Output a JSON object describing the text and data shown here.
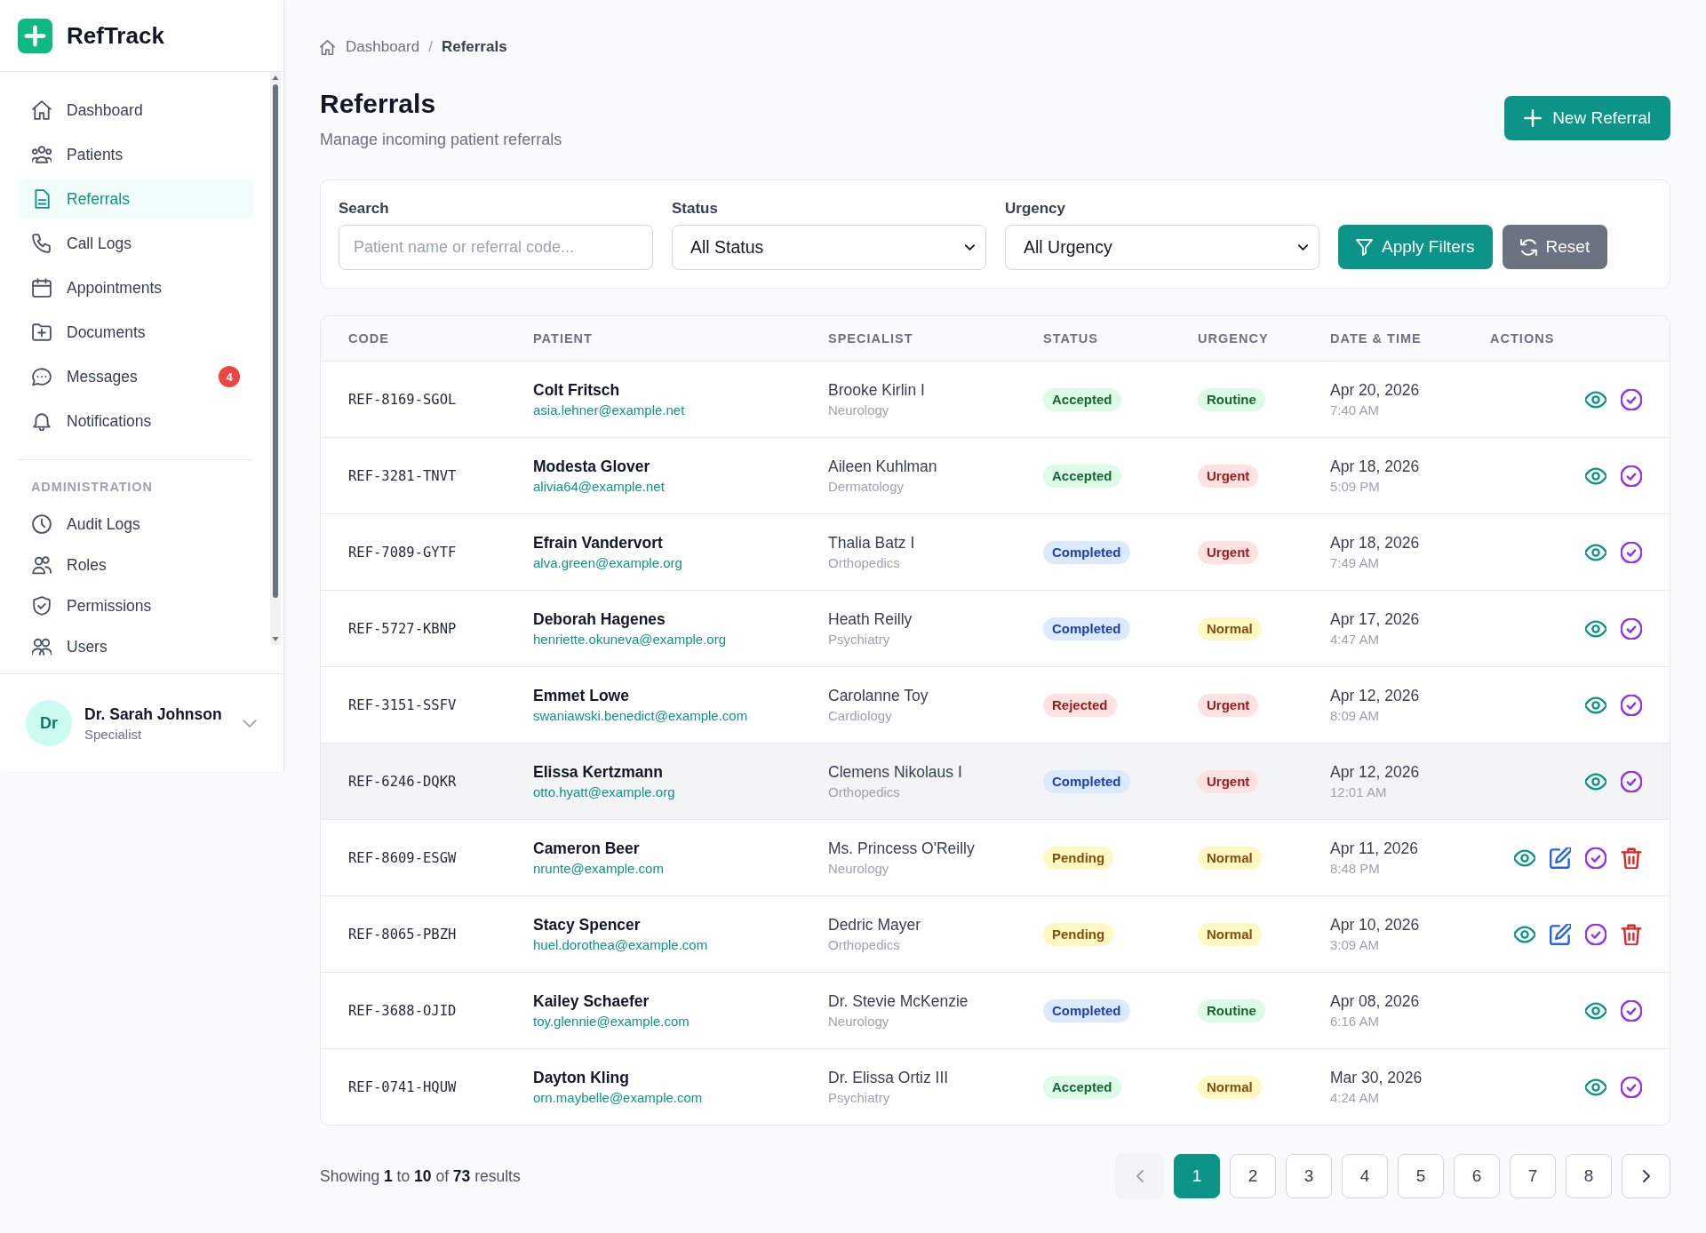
{
  "sidebar": {
    "brand": "RefTrack",
    "nav": [
      {
        "label": "Dashboard",
        "selected": false
      },
      {
        "label": "Patients",
        "selected": false
      },
      {
        "label": "Referrals",
        "selected": true
      },
      {
        "label": "Call Logs",
        "selected": false
      },
      {
        "label": "Appointments",
        "selected": false
      },
      {
        "label": "Documents",
        "selected": false
      },
      {
        "label": "Messages",
        "selected": false,
        "badge": "4"
      },
      {
        "label": "Notifications",
        "selected": false
      }
    ],
    "section_title": "ADMINISTRATION",
    "admin_nav": [
      {
        "label": "Audit Logs",
        "selected": false
      },
      {
        "label": "Roles",
        "selected": false
      },
      {
        "label": "Permissions",
        "selected": false
      },
      {
        "label": "Users",
        "selected": false
      }
    ],
    "user": {
      "initials": "Dr",
      "name": "Dr. Sarah Johnson",
      "role": "Specialist"
    }
  },
  "breadcrumb": {
    "items": [
      "Dashboard",
      "Referrals"
    ],
    "separator": "/"
  },
  "header": {
    "title": "Referrals",
    "subtitle": "Manage incoming patient referrals",
    "action": "New Referral"
  },
  "filters": {
    "search": {
      "label": "Search",
      "placeholder": "Patient name or referral code..."
    },
    "status": {
      "label": "Status",
      "value": "All Status"
    },
    "urgency": {
      "label": "Urgency",
      "value": "All Urgency"
    },
    "apply": "Apply Filters",
    "reset": "Reset"
  },
  "table": {
    "columns": [
      "CODE",
      "PATIENT",
      "SPECIALIST",
      "STATUS",
      "URGENCY",
      "DATE & TIME",
      "ACTIONS"
    ],
    "rows": [
      {
        "code": "REF-8169-SGOL",
        "patient": {
          "name": "Colt Fritsch",
          "email": "asia.lehner@example.net"
        },
        "specialist": {
          "name": "Brooke Kirlin I",
          "specialty": "Neurology"
        },
        "status": {
          "label": "Accepted",
          "color": "#dcfce7"
        },
        "urgency": {
          "label": "Routine",
          "color": "#dcfce7"
        },
        "date": "Apr 20, 2026",
        "time": "7:40 AM",
        "hovered": false,
        "actions": [
          {
            "kind": "view"
          },
          {
            "kind": "approve"
          }
        ]
      },
      {
        "code": "REF-3281-TNVT",
        "patient": {
          "name": "Modesta Glover",
          "email": "alivia64@example.net"
        },
        "specialist": {
          "name": "Aileen Kuhlman",
          "specialty": "Dermatology"
        },
        "status": {
          "label": "Accepted",
          "color": "#dcfce7"
        },
        "urgency": {
          "label": "Urgent",
          "color": "#fee2e2"
        },
        "date": "Apr 18, 2026",
        "time": "5:09 PM",
        "hovered": false,
        "actions": [
          {
            "kind": "view"
          },
          {
            "kind": "approve"
          }
        ]
      },
      {
        "code": "REF-7089-GYTF",
        "patient": {
          "name": "Efrain Vandervort",
          "email": "alva.green@example.org"
        },
        "specialist": {
          "name": "Thalia Batz I",
          "specialty": "Orthopedics"
        },
        "status": {
          "label": "Completed",
          "color": "#dbeafe"
        },
        "urgency": {
          "label": "Urgent",
          "color": "#fee2e2"
        },
        "date": "Apr 18, 2026",
        "time": "7:49 AM",
        "hovered": false,
        "actions": [
          {
            "kind": "view"
          },
          {
            "kind": "approve"
          }
        ]
      },
      {
        "code": "REF-5727-KBNP",
        "patient": {
          "name": "Deborah Hagenes",
          "email": "henriette.okuneva@example.org"
        },
        "specialist": {
          "name": "Heath Reilly",
          "specialty": "Psychiatry"
        },
        "status": {
          "label": "Completed",
          "color": "#dbeafe"
        },
        "urgency": {
          "label": "Normal",
          "color": "#fef9c3"
        },
        "date": "Apr 17, 2026",
        "time": "4:47 AM",
        "hovered": false,
        "actions": [
          {
            "kind": "view"
          },
          {
            "kind": "approve"
          }
        ]
      },
      {
        "code": "REF-3151-SSFV",
        "patient": {
          "name": "Emmet Lowe",
          "email": "swaniawski.benedict@example.com"
        },
        "specialist": {
          "name": "Carolanne Toy",
          "specialty": "Cardiology"
        },
        "status": {
          "label": "Rejected",
          "color": "#fee2e2"
        },
        "urgency": {
          "label": "Urgent",
          "color": "#fee2e2"
        },
        "date": "Apr 12, 2026",
        "time": "8:09 AM",
        "hovered": false,
        "actions": [
          {
            "kind": "view"
          },
          {
            "kind": "approve"
          }
        ]
      },
      {
        "code": "REF-6246-DQKR",
        "patient": {
          "name": "Elissa Kertzmann",
          "email": "otto.hyatt@example.org"
        },
        "specialist": {
          "name": "Clemens Nikolaus I",
          "specialty": "Orthopedics"
        },
        "status": {
          "label": "Completed",
          "color": "#dbeafe"
        },
        "urgency": {
          "label": "Urgent",
          "color": "#fee2e2"
        },
        "date": "Apr 12, 2026",
        "time": "12:01 AM",
        "hovered": true,
        "actions": [
          {
            "kind": "view"
          },
          {
            "kind": "approve"
          }
        ]
      },
      {
        "code": "REF-8609-ESGW",
        "patient": {
          "name": "Cameron Beer",
          "email": "nrunte@example.com"
        },
        "specialist": {
          "name": "Ms. Princess O'Reilly",
          "specialty": "Neurology"
        },
        "status": {
          "label": "Pending",
          "color": "#fef9c3"
        },
        "urgency": {
          "label": "Normal",
          "color": "#fef9c3"
        },
        "date": "Apr 11, 2026",
        "time": "8:48 PM",
        "hovered": false,
        "actions": [
          {
            "kind": "view"
          },
          {
            "kind": "edit"
          },
          {
            "kind": "approve"
          },
          {
            "kind": "delete"
          }
        ]
      },
      {
        "code": "REF-8065-PBZH",
        "patient": {
          "name": "Stacy Spencer",
          "email": "huel.dorothea@example.com"
        },
        "specialist": {
          "name": "Dedric Mayer",
          "specialty": "Orthopedics"
        },
        "status": {
          "label": "Pending",
          "color": "#fef9c3"
        },
        "urgency": {
          "label": "Normal",
          "color": "#fef9c3"
        },
        "date": "Apr 10, 2026",
        "time": "3:09 AM",
        "hovered": false,
        "actions": [
          {
            "kind": "view"
          },
          {
            "kind": "edit"
          },
          {
            "kind": "approve"
          },
          {
            "kind": "delete"
          }
        ]
      },
      {
        "code": "REF-3688-OJID",
        "patient": {
          "name": "Kailey Schaefer",
          "email": "toy.glennie@example.com"
        },
        "specialist": {
          "name": "Dr. Stevie McKenzie",
          "specialty": "Neurology"
        },
        "status": {
          "label": "Completed",
          "color": "#dbeafe"
        },
        "urgency": {
          "label": "Routine",
          "color": "#dcfce7"
        },
        "date": "Apr 08, 2026",
        "time": "6:16 AM",
        "hovered": false,
        "actions": [
          {
            "kind": "view"
          },
          {
            "kind": "approve"
          }
        ]
      },
      {
        "code": "REF-0741-HQUW",
        "patient": {
          "name": "Dayton Kling",
          "email": "orn.maybelle@example.com"
        },
        "specialist": {
          "name": "Dr. Elissa Ortiz III",
          "specialty": "Psychiatry"
        },
        "status": {
          "label": "Accepted",
          "color": "#dcfce7"
        },
        "urgency": {
          "label": "Normal",
          "color": "#fef9c3"
        },
        "date": "Mar 30, 2026",
        "time": "4:24 AM",
        "hovered": false,
        "actions": [
          {
            "kind": "view"
          },
          {
            "kind": "approve"
          }
        ]
      }
    ]
  },
  "pagination": {
    "summary": "Showing **1** to **10** of **73** results",
    "prev": {
      "disabled": true
    },
    "pages": [
      {
        "label": "1",
        "selected": true
      },
      {
        "label": "2",
        "selected": false
      },
      {
        "label": "3",
        "selected": false
      },
      {
        "label": "4",
        "selected": false
      },
      {
        "label": "5",
        "selected": false
      },
      {
        "label": "6",
        "selected": false
      },
      {
        "label": "7",
        "selected": false
      },
      {
        "label": "8",
        "selected": false
      }
    ],
    "next": {
      "disabled": false
    }
  }
}
